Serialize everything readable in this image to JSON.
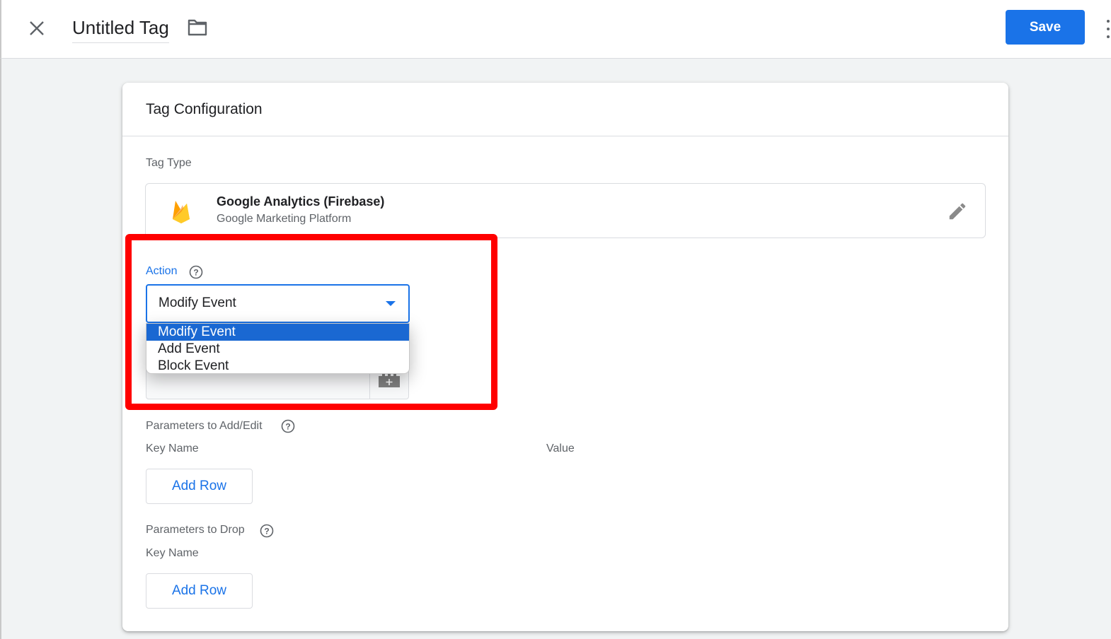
{
  "topbar": {
    "title": "Untitled Tag",
    "save_label": "Save",
    "icons": {
      "close": "close-icon",
      "folder": "folder-icon",
      "more": "more-vert-icon"
    }
  },
  "card": {
    "header": "Tag Configuration",
    "tag_type": {
      "label": "Tag Type",
      "name": "Google Analytics (Firebase)",
      "vendor": "Google Marketing Platform",
      "icon": "firebase-icon",
      "edit_icon": "pencil-icon"
    },
    "action": {
      "label": "Action",
      "selected": "Modify Event",
      "options": [
        "Modify Event",
        "Add Event",
        "Block Event"
      ],
      "highlighted_option": "Modify Event"
    },
    "params_add_edit": {
      "label": "Parameters to Add/Edit",
      "columns": [
        "Key Name",
        "Value"
      ],
      "add_row_label": "Add Row"
    },
    "params_drop": {
      "label": "Parameters to Drop",
      "columns": [
        "Key Name"
      ],
      "add_row_label": "Add Row"
    }
  },
  "colors": {
    "accent": "#1a73e8",
    "highlight_box": "#ff0000",
    "selected_option": "#1a68d2"
  }
}
